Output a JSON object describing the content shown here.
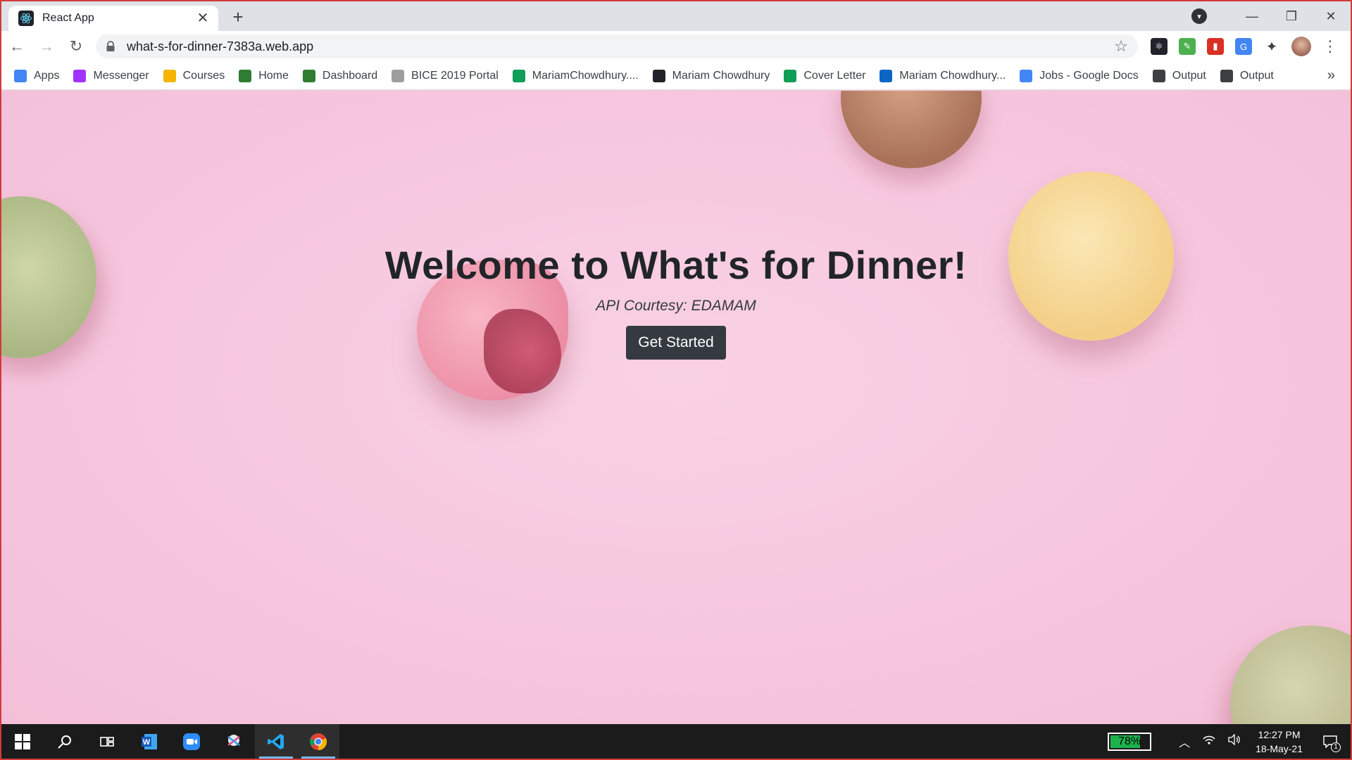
{
  "browser": {
    "tab": {
      "title": "React App",
      "close": "✕"
    },
    "new_tab": "+",
    "window": {
      "minimize": "—",
      "restore": "❐",
      "close": "✕",
      "profile_menu": "▾"
    },
    "nav": {
      "back": "←",
      "forward": "→",
      "reload": "↻"
    },
    "url": "what-s-for-dinner-7383a.web.app",
    "bookmark_star": "☆",
    "menu": "⋮"
  },
  "bookmarks": [
    {
      "label": "Apps",
      "icon": "apps-grid-icon",
      "color": "#4285f4"
    },
    {
      "label": "Messenger",
      "icon": "messenger-icon",
      "color": "#a033ff"
    },
    {
      "label": "Courses",
      "icon": "classroom-icon",
      "color": "#f4b400"
    },
    {
      "label": "Home",
      "icon": "shield-icon",
      "color": "#2e7d32"
    },
    {
      "label": "Dashboard",
      "icon": "shield-icon",
      "color": "#2e7d32"
    },
    {
      "label": "BICE 2019 Portal",
      "icon": "portal-icon",
      "color": "#9e9e9e"
    },
    {
      "label": "MariamChowdhury....",
      "icon": "google-drive-icon",
      "color": "#0f9d58"
    },
    {
      "label": "Mariam Chowdhury",
      "icon": "react-icon",
      "color": "#20232a"
    },
    {
      "label": "Cover Letter",
      "icon": "google-drive-icon",
      "color": "#0f9d58"
    },
    {
      "label": "Mariam Chowdhury...",
      "icon": "linkedin-icon",
      "color": "#0a66c2"
    },
    {
      "label": "Jobs - Google Docs",
      "icon": "google-docs-icon",
      "color": "#4285f4"
    },
    {
      "label": "Output",
      "icon": "globe-icon",
      "color": "#3c4043"
    },
    {
      "label": "Output",
      "icon": "globe-icon",
      "color": "#3c4043"
    }
  ],
  "bookmarks_more": "»",
  "hero": {
    "title": "Welcome to What's for Dinner!",
    "subtitle": "API Courtesy: EDAMAM",
    "button": "Get Started"
  },
  "taskbar": {
    "apps": [
      "start-icon",
      "search-icon",
      "task-view-icon",
      "word-icon",
      "zoom-icon",
      "snipping-icon",
      "vscode-icon",
      "chrome-icon"
    ],
    "battery_level": 0.78,
    "battery_text": "78%",
    "time": "12:27 PM",
    "date": "18-May-21",
    "notifications": "1"
  },
  "colors": {
    "page_background": "#f7c9df",
    "button": "#343a40",
    "title_text": "#212529"
  }
}
